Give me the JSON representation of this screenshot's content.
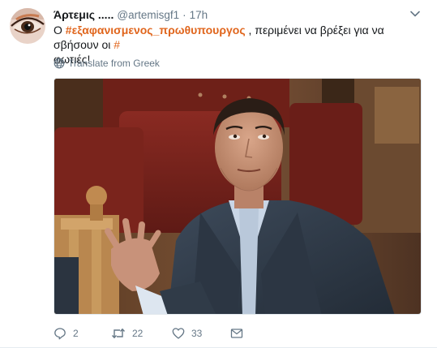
{
  "tweet": {
    "author": {
      "fullname": "Άρτεμις .....",
      "username": "@artemisgf1",
      "avatar_icon": "avatar-eye-makeup"
    },
    "separator": "·",
    "time": "17h",
    "text": {
      "prefix": "Ο ",
      "hashtag": "#εξαφανισμενος_πρωθυπουργος",
      "middle": " , περιμένει να βρέξει για να σβήσουν οι ",
      "trailing_hash": "#",
      "suffix": "φωτιές!"
    },
    "translate_label": "Translate from Greek",
    "media": {
      "type": "photo"
    },
    "actions": {
      "reply_count": "2",
      "retweet_count": "22",
      "like_count": "33"
    },
    "colors": {
      "hashtag": "#e0651c",
      "muted": "#657786",
      "text": "#14171a"
    }
  }
}
